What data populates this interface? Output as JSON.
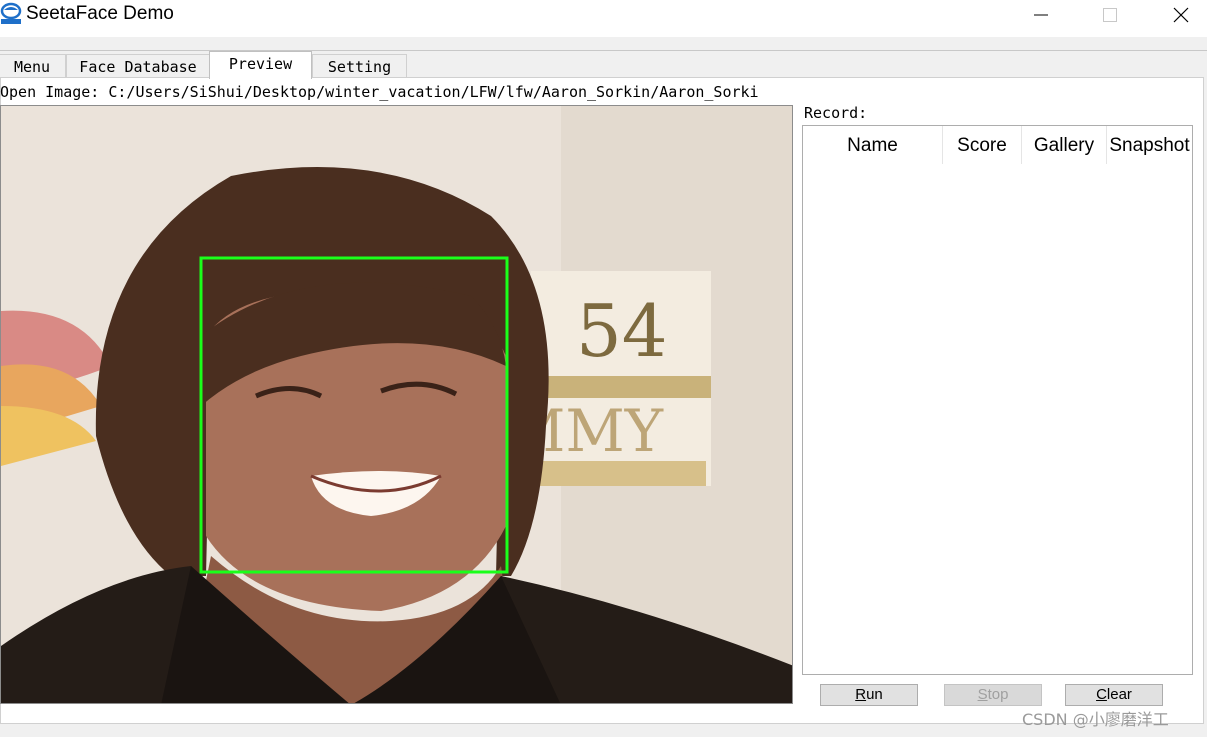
{
  "window": {
    "title": "SeetaFace Demo",
    "controls": [
      "minimize",
      "maximize",
      "close"
    ]
  },
  "tabs": [
    {
      "label": "Menu",
      "active": false
    },
    {
      "label": "Face Database",
      "active": false
    },
    {
      "label": "Preview",
      "active": true
    },
    {
      "label": "Setting",
      "active": false
    }
  ],
  "preview": {
    "open_image_text": "Open Image: C:/Users/SiShui/Desktop/winter_vacation/LFW/lfw/Aaron_Sorkin/Aaron_Sorkin",
    "image_sign_text": "54",
    "image_sign_text2": "MMY",
    "detection_box_color": "#1aff1a"
  },
  "record": {
    "label": "Record:",
    "columns": [
      "Name",
      "Score",
      "Gallery",
      "Snapshot"
    ],
    "rows": []
  },
  "buttons": {
    "run": {
      "first": "R",
      "rest": "un",
      "enabled": true
    },
    "stop": {
      "first": "S",
      "rest": "top",
      "enabled": false
    },
    "clear": {
      "first": "C",
      "rest": "lear",
      "enabled": true
    }
  },
  "watermark": "CSDN @小廖磨洋工"
}
